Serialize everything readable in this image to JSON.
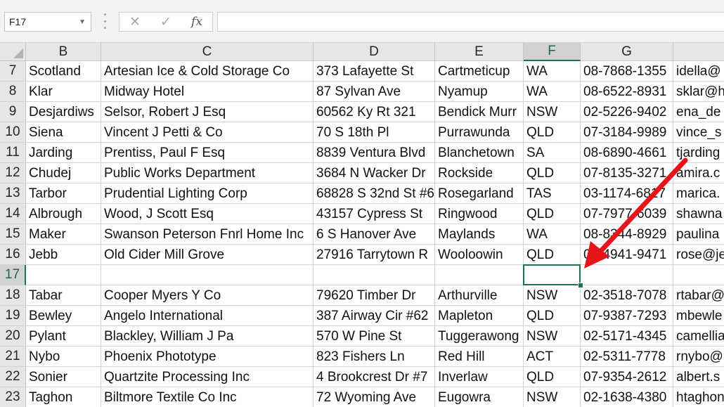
{
  "formula_bar": {
    "name_box": "F17",
    "cancel_icon": "✕",
    "enter_icon": "✓",
    "fx_label": "fx",
    "formula_value": ""
  },
  "columns": [
    "B",
    "C",
    "D",
    "E",
    "F",
    "G",
    ""
  ],
  "selected_column": "F",
  "selected_row": "17",
  "rows": [
    {
      "num": "7",
      "cells": [
        "Scotland",
        "Artesian Ice & Cold Storage Co",
        "373 Lafayette St",
        "Cartmeticup",
        "WA",
        "08-7868-1355",
        "idella@"
      ]
    },
    {
      "num": "8",
      "cells": [
        "Klar",
        "Midway Hotel",
        "87 Sylvan Ave",
        "Nyamup",
        "WA",
        "08-6522-8931",
        "sklar@h"
      ]
    },
    {
      "num": "9",
      "cells": [
        "Desjardiws",
        "Selsor, Robert J Esq",
        "60562 Ky Rt 321",
        "Bendick Murr",
        "NSW",
        "02-5226-9402",
        "ena_de"
      ]
    },
    {
      "num": "10",
      "cells": [
        "Siena",
        "Vincent J Petti & Co",
        "70 S 18th Pl",
        "Purrawunda",
        "QLD",
        "07-3184-9989",
        "vince_s"
      ]
    },
    {
      "num": "11",
      "cells": [
        "Jarding",
        "Prentiss, Paul F Esq",
        "8839 Ventura Blvd",
        "Blanchetown",
        "SA",
        "08-6890-4661",
        "tjarding"
      ]
    },
    {
      "num": "12",
      "cells": [
        "Chudej",
        "Public Works Department",
        "3684 N Wacker Dr",
        "Rockside",
        "QLD",
        "07-8135-3271",
        "amira.c"
      ]
    },
    {
      "num": "13",
      "cells": [
        "Tarbor",
        "Prudential Lighting Corp",
        "68828 S 32nd St #6",
        "Rosegarland",
        "TAS",
        "03-1174-6817",
        "marica."
      ]
    },
    {
      "num": "14",
      "cells": [
        "Albrough",
        "Wood, J Scott Esq",
        "43157 Cypress St",
        "Ringwood",
        "QLD",
        "07-7977-6039",
        "shawna"
      ]
    },
    {
      "num": "15",
      "cells": [
        "Maker",
        "Swanson Peterson Fnrl Home Inc",
        "6 S Hanover Ave",
        "Maylands",
        "WA",
        "08-8344-8929",
        "paulina"
      ]
    },
    {
      "num": "16",
      "cells": [
        "Jebb",
        "Old Cider Mill Grove",
        "27916 Tarrytown R",
        "Wooloowin",
        "QLD",
        "07-4941-9471",
        "rose@je"
      ]
    },
    {
      "num": "17",
      "cells": [
        "",
        "",
        "",
        "",
        "",
        "",
        ""
      ]
    },
    {
      "num": "18",
      "cells": [
        "Tabar",
        "Cooper Myers Y Co",
        "79620 Timber Dr",
        "Arthurville",
        "NSW",
        "02-3518-7078",
        "rtabar@"
      ]
    },
    {
      "num": "19",
      "cells": [
        "Bewley",
        "Angelo International",
        "387 Airway Cir #62",
        "Mapleton",
        "QLD",
        "07-9387-7293",
        "mbewle"
      ]
    },
    {
      "num": "20",
      "cells": [
        "Pylant",
        "Blackley, William J Pa",
        "570 W Pine St",
        "Tuggerawong",
        "NSW",
        "02-5171-4345",
        "camellia"
      ]
    },
    {
      "num": "21",
      "cells": [
        "Nybo",
        "Phoenix Phototype",
        "823 Fishers Ln",
        "Red Hill",
        "ACT",
        "02-5311-7778",
        "rnybo@"
      ]
    },
    {
      "num": "22",
      "cells": [
        "Sonier",
        "Quartzite Processing Inc",
        "4 Brookcrest Dr #7",
        "Inverlaw",
        "QLD",
        "07-9354-2612",
        "albert.s"
      ]
    },
    {
      "num": "23",
      "cells": [
        "Taghon",
        "Biltmore Textile Co Inc",
        "72 Wyoming Ave",
        "Eugowra",
        "NSW",
        "02-1638-4380",
        "htaghon"
      ]
    }
  ],
  "colors": {
    "selection_green": "#217346",
    "annotation_arrow": "#e8141b"
  }
}
